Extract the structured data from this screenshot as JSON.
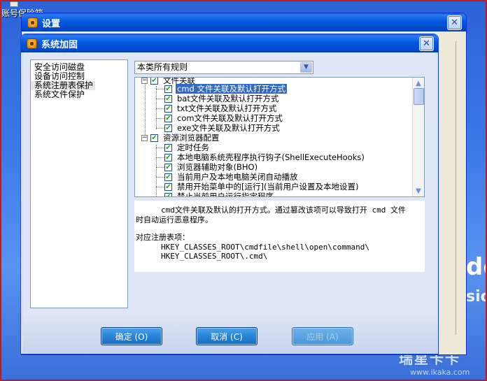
{
  "desktop": {
    "icon_label": "账号保险箱",
    "os_brand_fragment": [
      "",
      "do",
      "sio"
    ],
    "watermark": {
      "line1": "瑞星卡卡",
      "line2": "www.ikaka.com"
    }
  },
  "back_window": {
    "title": "设置",
    "close": "✕"
  },
  "front_window": {
    "title": "系统加固",
    "close": "✕"
  },
  "categories": [
    {
      "label": "安全访问磁盘"
    },
    {
      "label": "设备访问控制"
    },
    {
      "label": "系统注册表保护"
    },
    {
      "label": "系统文件保护"
    }
  ],
  "rule_filter": {
    "selected": "本类所有规则"
  },
  "tree": {
    "groups": [
      {
        "label": "文件关联",
        "expander": "−",
        "items": [
          {
            "label": "cmd 文件关联及默认打开方式",
            "checked": true,
            "selected": true
          },
          {
            "label": "bat文件关联及默认打开方式",
            "checked": true
          },
          {
            "label": "txt文件关联及默认打开方式",
            "checked": true
          },
          {
            "label": "com文件关联及默认打开方式",
            "checked": true
          },
          {
            "label": "exe文件关联及默认打开方式",
            "checked": true
          }
        ]
      },
      {
        "label": "资源浏览器配置",
        "expander": "−",
        "items": [
          {
            "label": "定时任务",
            "checked": true
          },
          {
            "label": "本地电脑系统壳程序执行钩子(ShellExecuteHooks)",
            "checked": true
          },
          {
            "label": "浏览器辅助对象(BHO)",
            "checked": true
          },
          {
            "label": "当前用户及本地电脑关闭自动播放",
            "checked": true
          },
          {
            "label": "禁用开始菜单中的[运行](当前用户设置及本地设置)",
            "checked": true
          },
          {
            "label": "禁止当前用户运行指定程序",
            "checked": true
          }
        ]
      }
    ]
  },
  "description": {
    "line1": "cmd文件关联及默认的打开方式。通过篡改该项可以导致打开 cmd 文件",
    "line2": "时自动运行恶意程序。",
    "reg_title": "对应注册表项：",
    "reg_key1": "HKEY_CLASSES_ROOT\\cmdfile\\shell\\open\\command\\",
    "reg_key2": "HKEY_CLASSES_ROOT\\.cmd\\"
  },
  "buttons": {
    "ok": "确定 (O)",
    "cancel": "取消 (C)",
    "apply": "应用 (A)"
  },
  "scrollbar": {
    "up": "▲",
    "down": "▼"
  },
  "combo_arrow": "▼"
}
